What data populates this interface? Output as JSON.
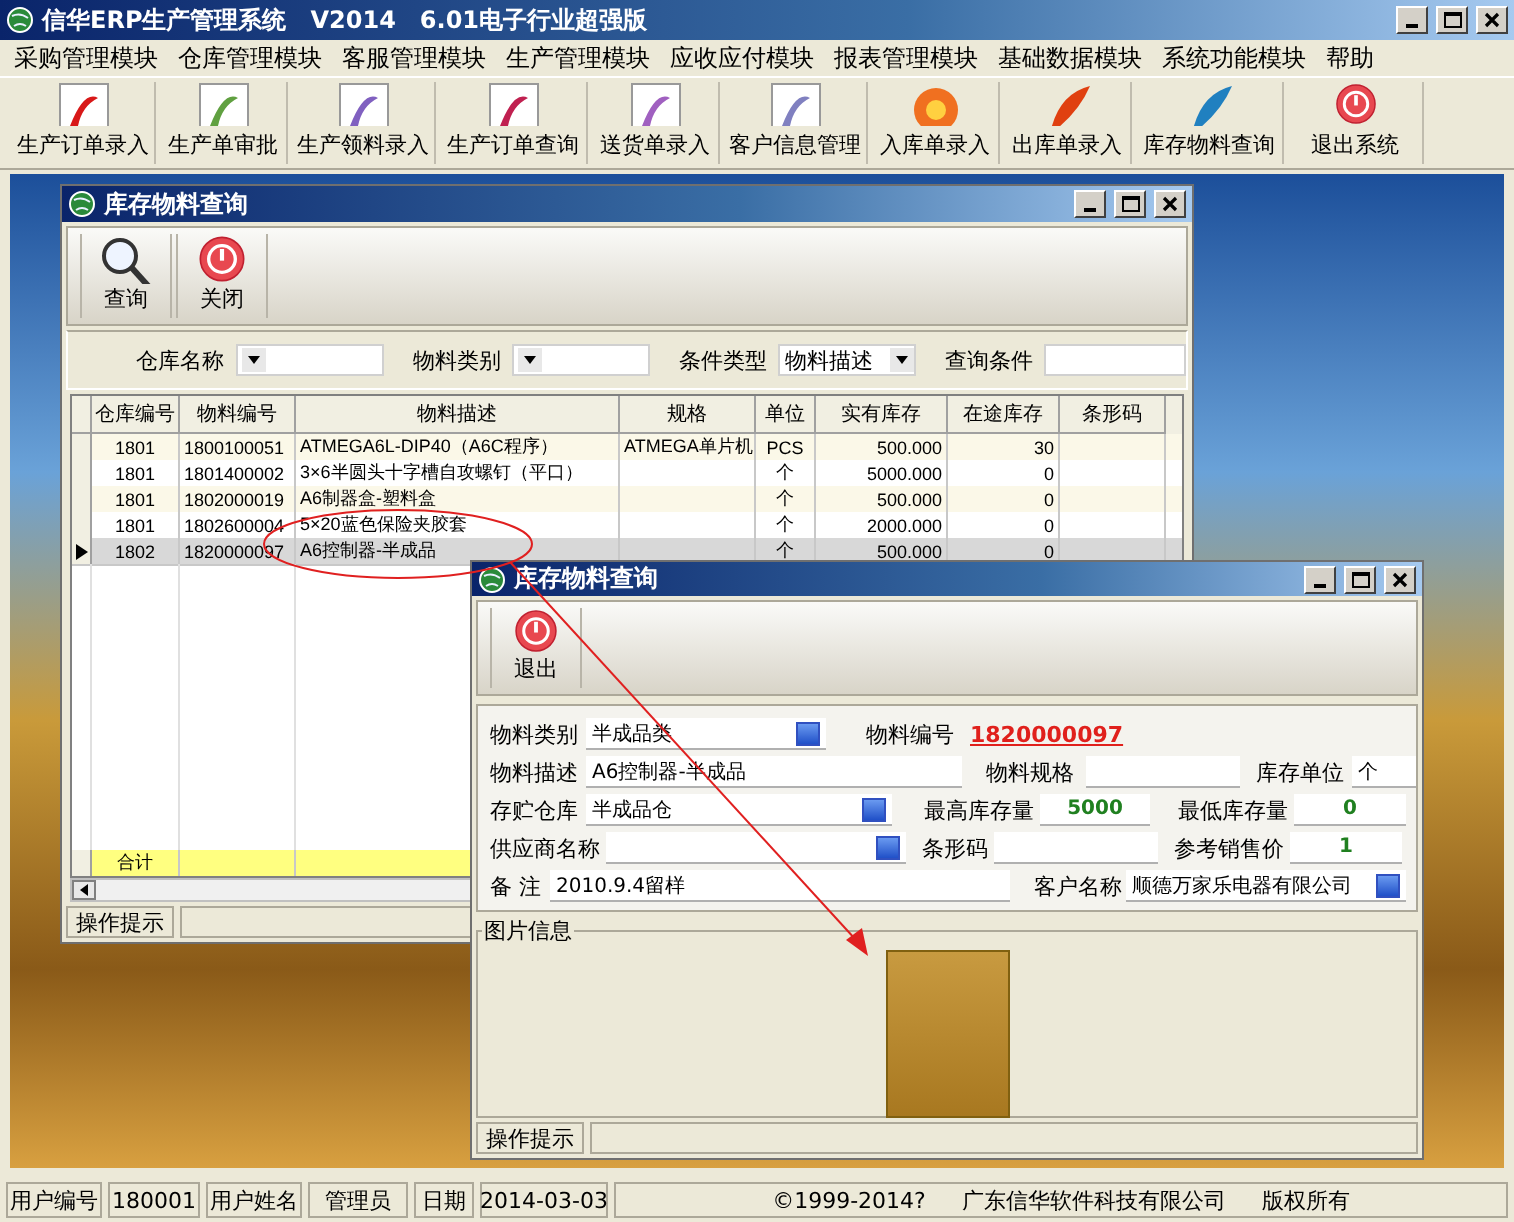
{
  "window": {
    "title": "信华ERP生产管理系统　V2014　6.01电子行业超强版"
  },
  "menu": [
    "采购管理模块",
    "仓库管理模块",
    "客服管理模块",
    "生产管理模块",
    "应收应付模块",
    "报表管理模块",
    "基础数据模块",
    "系统功能模块",
    "帮助"
  ],
  "toolbar": [
    "生产订单录入",
    "生产单审批",
    "生产领料录入",
    "生产订单查询",
    "送货单录入",
    "客户信息管理",
    "入库单录入",
    "出库单录入",
    "库存物料查询",
    "退出系统"
  ],
  "inventory_window": {
    "title": "库存物料查询",
    "toolbar": [
      "查询",
      "关闭"
    ],
    "filters": [
      {
        "label": "仓库名称",
        "kind": "dropdown"
      },
      {
        "label": "物料类别",
        "kind": "dropdown"
      },
      {
        "label": "条件类型",
        "kind": "dropdown",
        "value": "物料描述"
      },
      {
        "label": "查询条件",
        "kind": "text"
      }
    ],
    "table": {
      "columns": [
        "仓库编号",
        "物料编号",
        "物料描述",
        "规格",
        "单位",
        "实有库存",
        "在途库存",
        "条形码"
      ],
      "rows": [
        {
          "selected": false,
          "cells": [
            "1801",
            "1800100051",
            "ATMEGA6L-DIP40（A6C程序）",
            "ATMEGA单片机",
            "PCS",
            "500.000",
            "30",
            ""
          ]
        },
        {
          "selected": false,
          "cells": [
            "1801",
            "1801400002",
            "3×6半圆头十字槽自攻螺钉（平口）",
            "",
            "个",
            "5000.000",
            "0",
            ""
          ]
        },
        {
          "selected": false,
          "cells": [
            "1801",
            "1802000019",
            "A6制器盒-塑料盒",
            "",
            "个",
            "500.000",
            "0",
            ""
          ]
        },
        {
          "selected": false,
          "cells": [
            "1801",
            "1802600004",
            "5×20蓝色保险夹胶套",
            "",
            "个",
            "2000.000",
            "0",
            ""
          ]
        },
        {
          "selected": true,
          "cells": [
            "1802",
            "1820000097",
            "A6控制器-半成品",
            "",
            "个",
            "500.000",
            "0",
            ""
          ]
        }
      ],
      "total_label": "合计"
    },
    "status": "操作提示"
  },
  "detail_window": {
    "title": "库存物料查询",
    "toolbar": [
      "退出"
    ],
    "rows": [
      [
        {
          "label": "物料类别",
          "value": "半成品类",
          "kind": "lookup"
        },
        {
          "label": "物料编号",
          "value": "1820000097",
          "kind": "link"
        }
      ],
      [
        {
          "label": "物料描述",
          "value": "A6控制器-半成品",
          "kind": "text"
        },
        {
          "label": "物料规格",
          "kind": "text"
        },
        {
          "label": "库存单位",
          "value": "个",
          "kind": "text"
        }
      ],
      [
        {
          "label": "存贮仓库",
          "value": "半成品仓",
          "kind": "lookup"
        },
        {
          "label": "最高库存量",
          "value": "5000",
          "kind": "number"
        },
        {
          "label": "最低库存量",
          "value": "0",
          "kind": "number"
        }
      ],
      [
        {
          "label": "供应商名称",
          "kind": "lookup"
        },
        {
          "label": "条形码",
          "kind": "text"
        },
        {
          "label": "参考销售价",
          "value": "1",
          "kind": "number"
        }
      ],
      [
        {
          "label": "备 注",
          "value": "2010.9.4留样",
          "kind": "text"
        },
        {
          "label": "客户名称",
          "value": "顺德万家乐电器有限公司",
          "kind": "lookup"
        }
      ]
    ],
    "picture_group": "图片信息",
    "status": "操作提示"
  },
  "status_bar": [
    {
      "text": "用户编号",
      "kind": "label"
    },
    {
      "text": "180001",
      "kind": "value"
    },
    {
      "text": "用户姓名",
      "kind": "label"
    },
    {
      "text": "管理员",
      "kind": "value"
    },
    {
      "text": "日期",
      "kind": "label"
    },
    {
      "text": "2014-03-03",
      "kind": "value"
    },
    {
      "text": "©1999-2014?",
      "kind": "wide"
    },
    {
      "text": "广东信华软件科技有限公司",
      "kind": "wide"
    },
    {
      "text": "版权所有",
      "kind": "wide"
    }
  ]
}
